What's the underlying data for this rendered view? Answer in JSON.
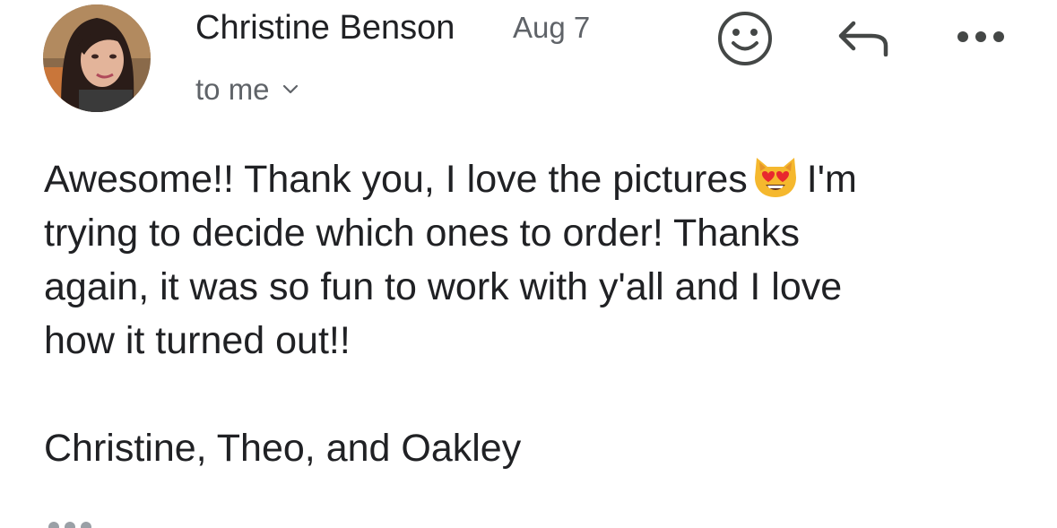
{
  "email": {
    "sender": "Christine Benson",
    "date": "Aug 7",
    "recipients_label": "to me",
    "body_line1_a": "Awesome!! Thank you, I love the pictures",
    "body_line1_b": "I'm",
    "body_line2": "trying to decide which ones to order! Thanks",
    "body_line3": "again, it was so fun to work with y'all and I love",
    "body_line4": "how it turned out!!",
    "signature": "Christine, Theo, and Oakley",
    "inline_emoji": "smiling-cat-heart-eyes-emoji"
  },
  "actions": {
    "emoji_icon": "smiley-icon",
    "reply_icon": "reply-arrow-icon",
    "more_icon": "more-horizontal-icon"
  },
  "colors": {
    "text": "#202124",
    "secondary": "#5f6368",
    "icon": "#444746"
  }
}
